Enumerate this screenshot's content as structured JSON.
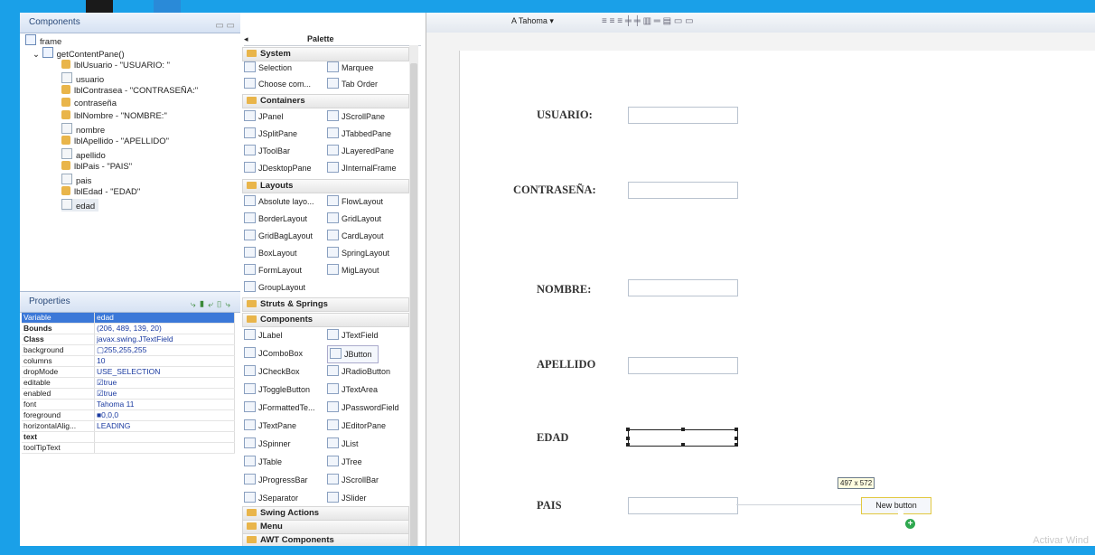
{
  "components_panel": {
    "title": "Components",
    "tree": [
      {
        "label": "frame",
        "icon": "frame-icon"
      },
      {
        "label": "getContentPane()",
        "icon": "panel-icon"
      },
      {
        "label": "lblUsuario - \"USUARIO: \"",
        "icon": "label-icon"
      },
      {
        "label": "usuario",
        "icon": "textfield-icon"
      },
      {
        "label": "lblContrasea - \"CONTRASEÑA:\"",
        "icon": "label-icon"
      },
      {
        "label": "contraseña",
        "icon": "textfield-icon"
      },
      {
        "label": "lblNombre - \"NOMBRE:\"",
        "icon": "label-icon"
      },
      {
        "label": "nombre",
        "icon": "textfield-icon"
      },
      {
        "label": "lblApellido - \"APELLIDO\"",
        "icon": "label-icon"
      },
      {
        "label": "apellido",
        "icon": "textfield-icon"
      },
      {
        "label": "lblPais - \"PAIS\"",
        "icon": "label-icon"
      },
      {
        "label": "pais",
        "icon": "textfield-icon"
      },
      {
        "label": "lblEdad - \"EDAD\"",
        "icon": "label-icon"
      },
      {
        "label": "edad",
        "icon": "textfield-icon"
      }
    ]
  },
  "properties_panel": {
    "title": "Properties",
    "rows": [
      {
        "key": "Variable",
        "value": "edad"
      },
      {
        "key": "Bounds",
        "value": "(206, 489, 139, 20)"
      },
      {
        "key": "Class",
        "value": "javax.swing.JTextField"
      },
      {
        "key": "background",
        "value": "255,255,255"
      },
      {
        "key": "columns",
        "value": "10"
      },
      {
        "key": "dropMode",
        "value": "USE_SELECTION"
      },
      {
        "key": "editable",
        "value": "true"
      },
      {
        "key": "enabled",
        "value": "true"
      },
      {
        "key": "font",
        "value": "Tahoma 11"
      },
      {
        "key": "foreground",
        "value": "0,0,0"
      },
      {
        "key": "horizontalAlig...",
        "value": "LEADING"
      },
      {
        "key": "text",
        "value": ""
      },
      {
        "key": "toolTipText",
        "value": ""
      }
    ]
  },
  "palette": {
    "title": "Palette",
    "categories": [
      {
        "name": "System",
        "items": [
          "Selection",
          "Marquee",
          "Choose com...",
          "Tab Order"
        ]
      },
      {
        "name": "Containers",
        "items": [
          "JPanel",
          "JScrollPane",
          "JSplitPane",
          "JTabbedPane",
          "JToolBar",
          "JLayeredPane",
          "JDesktopPane",
          "JInternalFrame"
        ]
      },
      {
        "name": "Layouts",
        "items": [
          "Absolute layo...",
          "FlowLayout",
          "BorderLayout",
          "GridLayout",
          "GridBagLayout",
          "CardLayout",
          "BoxLayout",
          "SpringLayout",
          "FormLayout",
          "MigLayout",
          "GroupLayout"
        ]
      },
      {
        "name": "Struts & Springs",
        "items": []
      },
      {
        "name": "Components",
        "items": [
          "JLabel",
          "JTextField",
          "JComboBox",
          "JButton",
          "JCheckBox",
          "JRadioButton",
          "JToggleButton",
          "JTextArea",
          "JFormattedTe...",
          "JPasswordField",
          "JTextPane",
          "JEditorPane",
          "JSpinner",
          "JList",
          "JTable",
          "JTree",
          "JProgressBar",
          "JScrollBar",
          "JSeparator",
          "JSlider"
        ]
      },
      {
        "name": "Swing Actions",
        "items": []
      },
      {
        "name": "Menu",
        "items": []
      },
      {
        "name": "AWT Components",
        "items": []
      }
    ]
  },
  "toolbar": {
    "font_combo": "Tahoma"
  },
  "form": {
    "labels": [
      "USUARIO:",
      "CONTRASEÑA:",
      "NOMBRE:",
      "APELLIDO",
      "EDAD",
      "PAIS"
    ],
    "size_tooltip": "497 x 572",
    "new_button_label": "New button"
  },
  "watermark": "Activar Wind"
}
